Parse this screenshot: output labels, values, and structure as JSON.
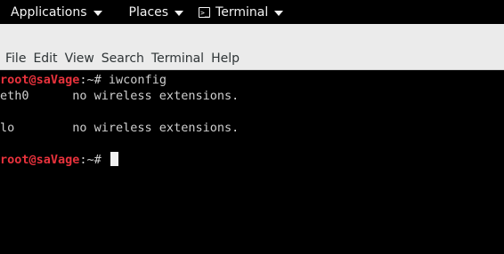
{
  "panel": {
    "applications": "Applications",
    "places": "Places",
    "terminal": "Terminal",
    "terminal_icon": ">_"
  },
  "menubar": {
    "items": [
      "File",
      "Edit",
      "View",
      "Search",
      "Terminal",
      "Help"
    ]
  },
  "terminal": {
    "prompt_user": "root@saVage",
    "prompt_path": ":~# ",
    "command": "iwconfig",
    "output": [
      "eth0      no wireless extensions.",
      "",
      "lo        no wireless extensions.",
      ""
    ],
    "colors": {
      "user": "#e8323c",
      "text": "#cfcfcf",
      "background": "#000000"
    }
  }
}
